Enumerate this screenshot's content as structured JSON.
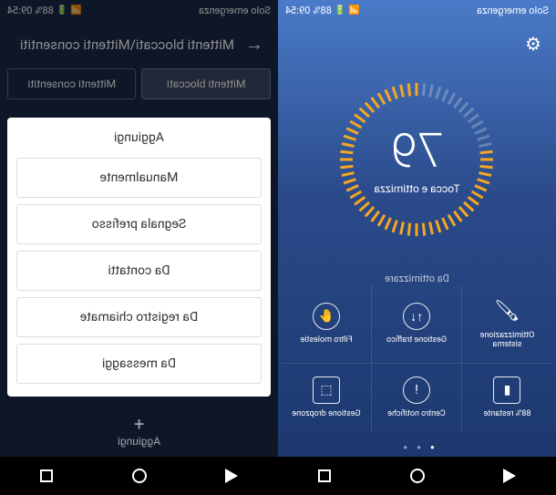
{
  "status": {
    "emergency": "Solo emergenza",
    "time": "09:54",
    "battery": "88%"
  },
  "left": {
    "breadcrumb": "Mittenti bloccati\\Mittenti consentiti",
    "tabs": {
      "blocked": "Mittenti bloccati",
      "allowed": "Mittenti consentiti"
    },
    "sheet": {
      "title": "Aggiungi",
      "options": {
        "manual": "Manualmente",
        "prefix": "Segnala prefisso",
        "contacts": "Da contatti",
        "calls": "Da registro chiamate",
        "messages": "Da messaggi"
      }
    },
    "footer_add": "Aggiungi"
  },
  "right": {
    "score": "79",
    "score_label": "Tocca e ottimizza",
    "note": "Da ottimizzare",
    "tiles": {
      "optimize": "Ottimizzazione sistema",
      "traffic": "Gestione traffico",
      "filter": "Filtro molestie",
      "battery": "88% restante",
      "notifications": "Centro notifiche",
      "dropzone": "Gestione dropzone"
    }
  }
}
